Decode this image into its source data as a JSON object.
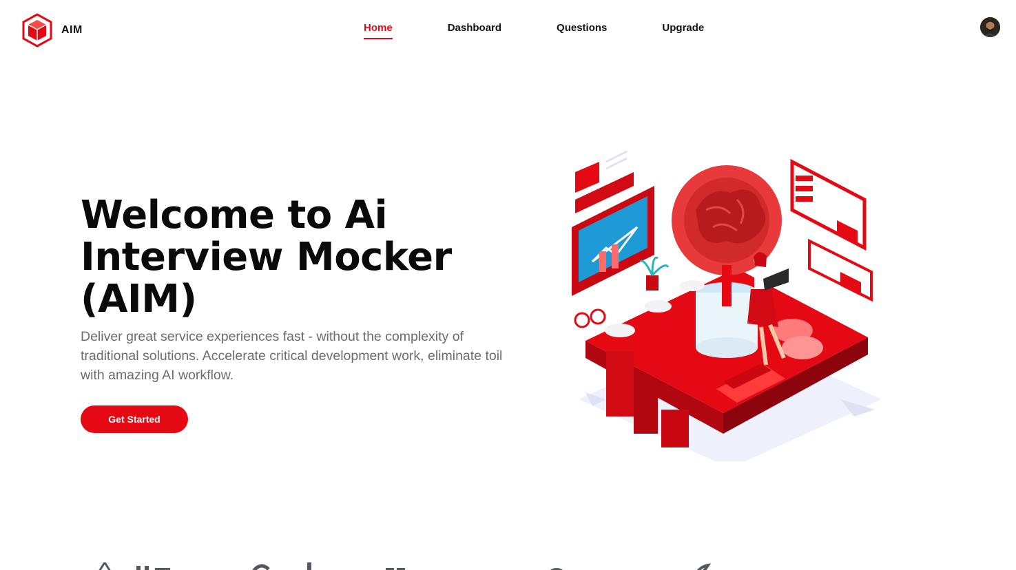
{
  "brand": {
    "name": "AIM",
    "logo_icon": "cube-logo-icon",
    "accent": "#e50914"
  },
  "nav": {
    "items": [
      {
        "label": "Home",
        "active": true
      },
      {
        "label": "Dashboard",
        "active": false
      },
      {
        "label": "Questions",
        "active": false
      },
      {
        "label": "Upgrade",
        "active": false
      }
    ]
  },
  "user": {
    "avatar_icon": "user-avatar"
  },
  "hero": {
    "title": "Welcome to Ai Interview Mocker (AIM)",
    "subtitle": "Deliver great service experiences fast - without the complexity of traditional solutions. Accelerate critical development work, eliminate toil with amazing AI workflow.",
    "cta_label": "Get Started",
    "illustration": "isometric-ai-brain-illustration"
  },
  "colors": {
    "accent": "#e50914",
    "text": "#0a0a0a",
    "muted": "#6b6b72",
    "logo_gray": "#55585e"
  }
}
